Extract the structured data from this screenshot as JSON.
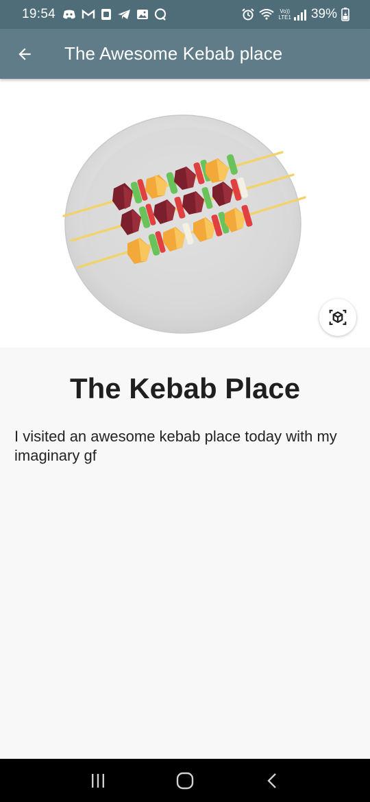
{
  "status_bar": {
    "time": "19:54",
    "battery": "39%",
    "notification_icons": [
      "discord-icon",
      "gmail-icon",
      "notes-icon",
      "telegram-icon",
      "gallery-icon",
      "messenger-icon"
    ],
    "right_icons": [
      "alarm-icon",
      "wifi-calling-icon",
      "lte-signal-icon",
      "battery-charging-icon"
    ],
    "network_label_top": "Vo))",
    "network_label_bottom": "LTE1"
  },
  "app_bar": {
    "title": "The Awesome Kebab place",
    "background": "#5f7c88"
  },
  "viewer": {
    "model": "kebab-plate",
    "ar_button_icon": "view-in-ar-icon"
  },
  "content": {
    "title": "The Kebab Place",
    "description": "I visited an awesome kebab place today with my imaginary gf"
  },
  "nav_bar": {
    "buttons": [
      "recents-icon",
      "home-icon",
      "back-icon"
    ]
  }
}
